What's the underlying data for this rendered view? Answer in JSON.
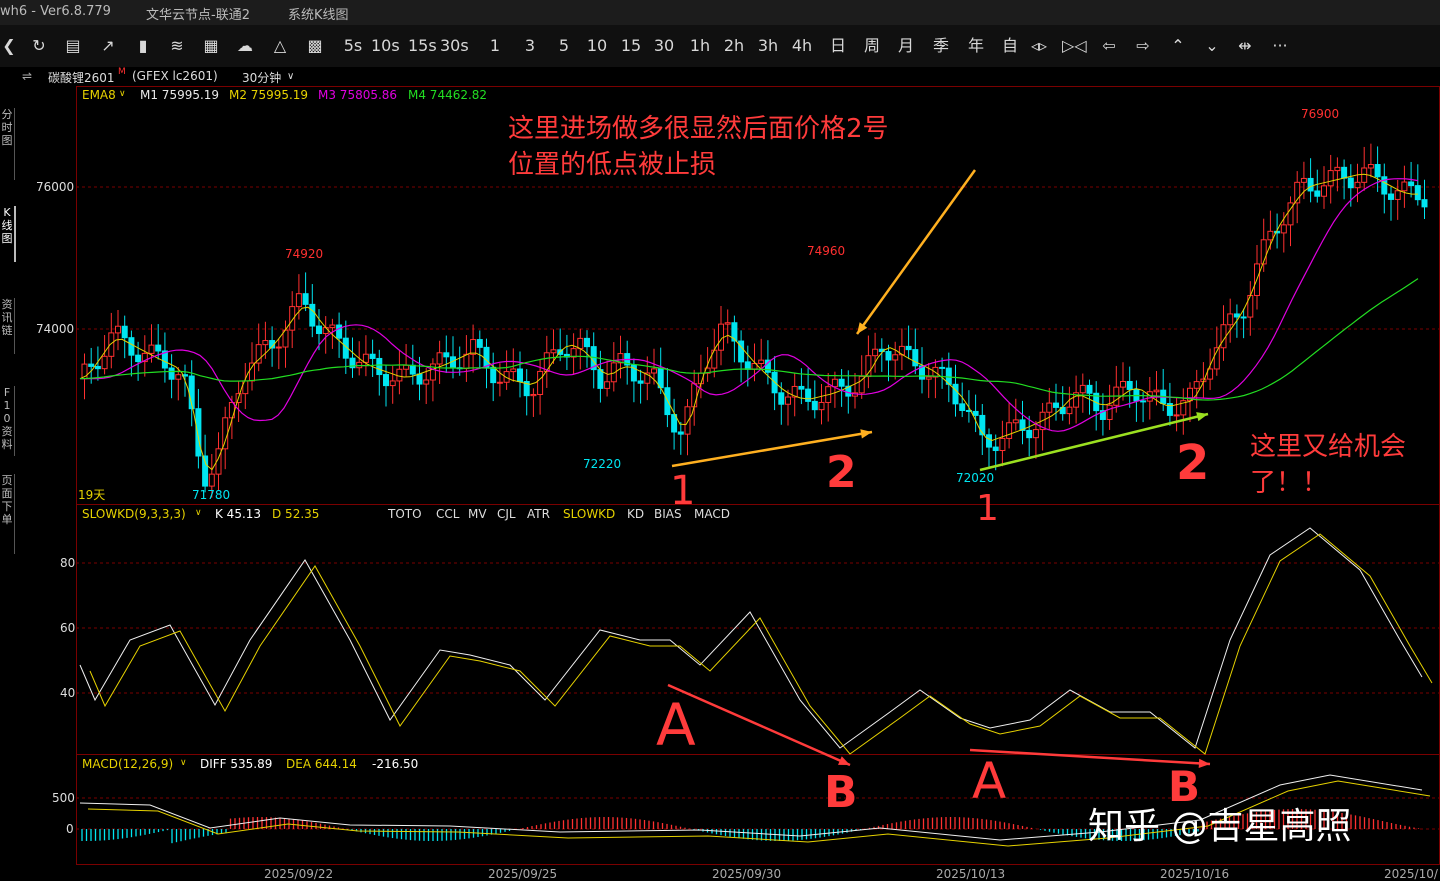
{
  "titlebar": {
    "app": "wh6  -  Ver6.8.779",
    "node": "文华云节点-联通2",
    "view": "系统K线图"
  },
  "toolbar": {
    "icons": [
      "back-icon",
      "refresh-icon",
      "list-icon",
      "line-chart-icon",
      "kline-icon",
      "tick-icon",
      "grid-icon",
      "cloud-icon",
      "bell-icon",
      "monitor-icon"
    ],
    "periods": [
      "5s",
      "10s",
      "15s",
      "30s",
      "1",
      "3",
      "5",
      "10",
      "15",
      "30",
      "1h",
      "2h",
      "3h",
      "4h",
      "日",
      "周",
      "月",
      "季",
      "年",
      "自"
    ],
    "nav_icons": [
      "expand-icon",
      "collapse-icon",
      "left-icon",
      "right-icon",
      "up-icon",
      "down-icon",
      "fit-icon",
      "more-icon"
    ]
  },
  "info": {
    "instrument_icon": "link-icon",
    "symbol": "碳酸锂2601",
    "symbol_mark": "M",
    "code": "(GFEX lc2601)",
    "period": "30分钟",
    "period_arrow": "v"
  },
  "left_tabs": [
    "分时图",
    "K线图",
    "资讯链",
    "F10资料",
    "页面下单"
  ],
  "main_legend": {
    "name": "EMA8",
    "m1": "M1 75995.19",
    "m2": "M2 75995.19",
    "m3": "M3 75805.86",
    "m4": "M4 74462.82",
    "m1_color": "#e8e8e8",
    "m2_color": "#e6d200",
    "m3_color": "#e000e0",
    "m4_color": "#22dd22"
  },
  "price_axis": [
    "76000",
    "74000"
  ],
  "price_labels": {
    "high1": "74920",
    "high2": "74960",
    "high3": "76900",
    "low1": "71780",
    "low2": "72220",
    "low3": "72020"
  },
  "days_label": "19天",
  "kd_legend": {
    "name": "SLOWKD(9,3,3,3)",
    "k": "K 45.13",
    "d": "D 52.35",
    "tabs": [
      "TOTO",
      "CCL",
      "MV",
      "CJL",
      "ATR",
      "SLOWKD",
      "KD",
      "BIAS",
      "MACD"
    ],
    "active_tab": "SLOWKD"
  },
  "kd_axis": [
    "80",
    "60",
    "40"
  ],
  "macd_legend": {
    "name": "MACD(12,26,9)",
    "diff": "DIFF 535.89",
    "dea": "DEA 644.14",
    "macd": "-216.50"
  },
  "macd_axis": [
    "500",
    "0"
  ],
  "dates": [
    "2025/09/22",
    "2025/09/25",
    "2025/09/30",
    "2025/10/13",
    "2025/10/16",
    "2025/10/"
  ],
  "annotations": {
    "top_note_line1": "这里进场做多很显然后面价格2号",
    "top_note_line2": "位置的低点被止损",
    "right_note_line1": "这里又给机会",
    "right_note_line2": "了！！",
    "mark_1a": "1",
    "mark_2a": "2",
    "mark_1b": "1",
    "mark_2b": "2",
    "mark_A1": "A",
    "mark_B1": "B",
    "mark_A2": "A",
    "mark_B2": "B"
  },
  "watermark": "知乎 @吉星高照",
  "colors": {
    "up": "#ff3030",
    "down": "#00e5f0",
    "grid": "#7a0000",
    "annotation": "#ff3b3b",
    "arrow_orange": "#ffb020",
    "arrow_green": "#9be020"
  }
}
